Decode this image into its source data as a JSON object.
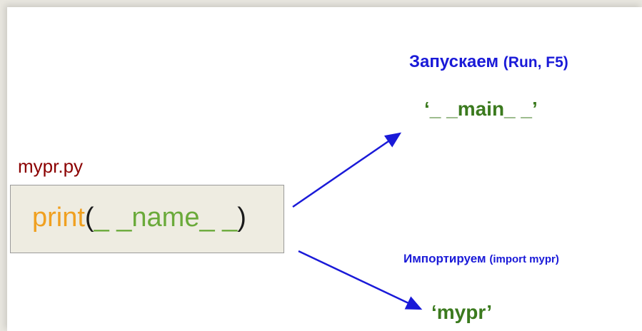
{
  "file_label": "mypr.py",
  "code": {
    "keyword": "print",
    "open_paren": "(",
    "name": "_ _name_ _",
    "close_paren": ")"
  },
  "run": {
    "label": "Запускаем",
    "hint": "(Run, F5)",
    "result": "‘_ _main_ _’"
  },
  "import": {
    "label": "Импортируем",
    "hint": "(import mypr)",
    "result": "‘mypr’"
  },
  "colors": {
    "arrow": "#1a1ad8",
    "value": "#3b7a1e",
    "file_label": "#8b0000",
    "keyword": "#f0a020",
    "name": "#6aaa3a",
    "code_box": "#eeece1"
  }
}
